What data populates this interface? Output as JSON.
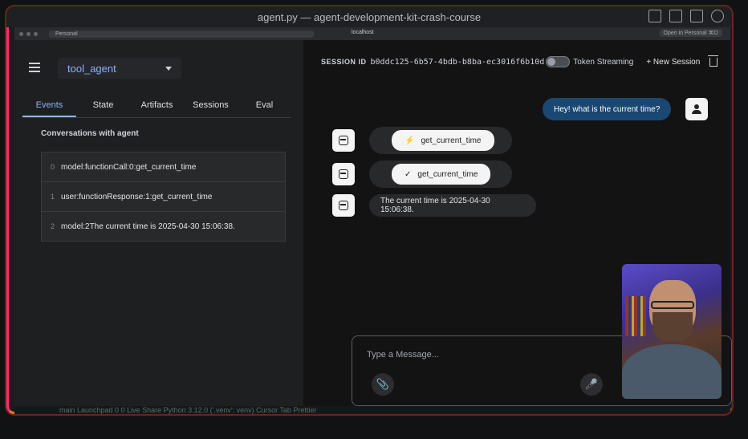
{
  "window": {
    "title": "agent.py — agent-development-kit-crash-course"
  },
  "browser": {
    "tab_label": "Personal",
    "url": "localhost",
    "open_in": "Open in Personal ⌘O"
  },
  "sidebar": {
    "agent_name": "tool_agent",
    "tabs": [
      "Events",
      "State",
      "Artifacts",
      "Sessions",
      "Eval"
    ],
    "conversations_title": "Conversations with agent",
    "events": [
      {
        "index": "0",
        "text": "model:functionCall:0:get_current_time"
      },
      {
        "index": "1",
        "text": "user:functionResponse:1:get_current_time"
      },
      {
        "index": "2",
        "text": "model:2The current time is 2025-04-30 15:06:38."
      }
    ]
  },
  "session": {
    "label": "SESSION ID",
    "id": "b0ddc125-6b57-4bdb-b8ba-ec3016f6b10d",
    "streaming_label": "Token Streaming",
    "new_session_label": "+ New Session"
  },
  "chat": {
    "user_message": "Hey! what is the current time?",
    "tool_call": {
      "icon": "⚡",
      "name": "get_current_time"
    },
    "tool_response": {
      "icon": "✓",
      "name": "get_current_time"
    },
    "bot_reply": "The current time is 2025-04-30 15:06:38."
  },
  "input": {
    "placeholder": "Type a Message..."
  },
  "status_bar": {
    "text": "main   Launchpad   0   0   Live Share   Python   3.12.0 ('.venv': venv)   Cursor Tab   Prettier"
  },
  "colors": {
    "accent": "#8ab4f8",
    "user_bubble": "#1a4872",
    "background": "#131314"
  }
}
